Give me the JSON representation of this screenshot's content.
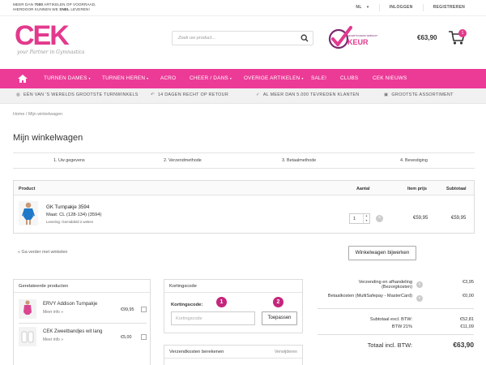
{
  "topbar": {
    "promo_pre": "MEER DAN ",
    "promo_count": "7000",
    "promo_mid": " ARTIKELEN OP VOORRAAD,",
    "promo_line2": "HIERDOOR KUNNEN WE ",
    "promo_bold": "SNEL",
    "promo_end": " LEVEREN!",
    "language": "NL",
    "login": "INLOGGEN",
    "register": "REGISTREREN"
  },
  "header": {
    "logo_text": "CEK",
    "logo_tagline": "your Partner in Gymnastics",
    "search_placeholder": "Zoek uw product...",
    "keur_small": "GECERTIFICEERD WEBSHOP",
    "keur_big": "KEUR",
    "cart_total": "€63,90",
    "cart_count": "1"
  },
  "nav": [
    "TURNEN DAMES",
    "TURNEN HEREN",
    "ACRO",
    "CHEER / DANS",
    "OVERIGE ARTIKELEN",
    "SALE!",
    "CLUBS",
    "CEK NIEUWS"
  ],
  "usp": [
    "EÉN VAN 'S WERELDS GROOTSTE TURNWINKELS",
    "14 DAGEN RECHT OP RETOUR",
    "AL MEER DAN 5.000 TEVREDEN KLANTEN",
    "GROOTSTE ASSORTIMENT"
  ],
  "breadcrumb": "Home / Mijn winkelwagen",
  "page_title": "Mijn winkelwagen",
  "steps": [
    "1.   Uw gegevens",
    "2.   Verzendmethode",
    "3.   Betaalmethode",
    "4.   Bevestiging"
  ],
  "table": {
    "col_product": "Product",
    "col_qty": "Aantal",
    "col_price": "Item prijs",
    "col_subtotal": "Subtotaal",
    "item": {
      "name": "GK Turnpakje 3594",
      "size": "Maat: CL (128-134) (3594)",
      "delivery": "Levering: Gemiddeld 2 weken",
      "qty": "1",
      "price": "€59,95",
      "subtotal": "€59,95"
    }
  },
  "continue_link": "« Ga verder met winkelen",
  "update_button": "Winkelwagen bijwerken",
  "related": {
    "title": "Gerelateerde producten",
    "items": [
      {
        "name": "ERVY Addison Turnpakje",
        "more": "Meer info »",
        "price": "€99,95"
      },
      {
        "name": "CEK Zweetbandjes wit lang",
        "more": "Meer info »",
        "price": "€5,00"
      }
    ]
  },
  "coupon": {
    "title": "Kortingscode",
    "label": "Kortingscode:",
    "placeholder": "Kortingscode",
    "apply": "Toepassen",
    "marker1": "1",
    "marker2": "2"
  },
  "shipping_calc": {
    "title": "Verzendkosten berekenen",
    "remove": "Verwijderen"
  },
  "summary": {
    "shipping_label": "Verzending en afhandeling",
    "shipping_sub": "(Bezorgkosten)",
    "shipping_value": "€3,95",
    "payment_label": "Betaalkosten (MultiSafepay - MasterCard)",
    "payment_value": "€0,00",
    "subtotal_label": "Subtotaal excl. BTW:",
    "subtotal_value": "€52,81",
    "vat_label": "BTW 21%",
    "vat_value": "€11,09",
    "total_label": "Totaal incl. BTW:",
    "total_value": "€63,90"
  },
  "colors": {
    "brand_pink": "#ec3a97",
    "marker": "#c4267c"
  }
}
